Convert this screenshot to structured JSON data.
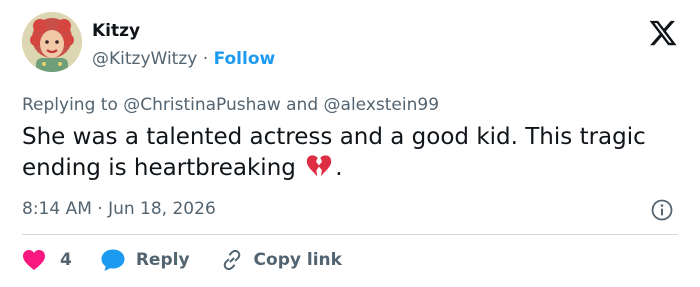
{
  "author": {
    "name": "Kitzy",
    "handle": "@KitzyWitzy",
    "separator": "·",
    "follow_label": "Follow"
  },
  "reply_context": {
    "prefix": "Replying to",
    "mention_1": "@ChristinaPushaw",
    "conjunction": "and",
    "mention_2": "@alexstein99"
  },
  "tweet": {
    "text_part_1": "She was a talented actress and a good kid. This tragic ending is heartbreaking",
    "emoji": "broken-heart",
    "text_part_2": ".",
    "timestamp": "8:14 AM · Jun 18, 2026"
  },
  "actions": {
    "like_count": "4",
    "reply_label": "Reply",
    "copy_link_label": "Copy link"
  },
  "icons": {
    "like": "heart-icon",
    "reply": "speech-bubble-icon",
    "copy": "link-icon",
    "info": "info-icon",
    "brand": "x-logo-icon"
  },
  "colors": {
    "text": "#0f1419",
    "muted": "#536471",
    "link": "#1d9bf0",
    "like": "#f91880",
    "reply": "#1d9bf0",
    "divider": "#cfd9de"
  }
}
